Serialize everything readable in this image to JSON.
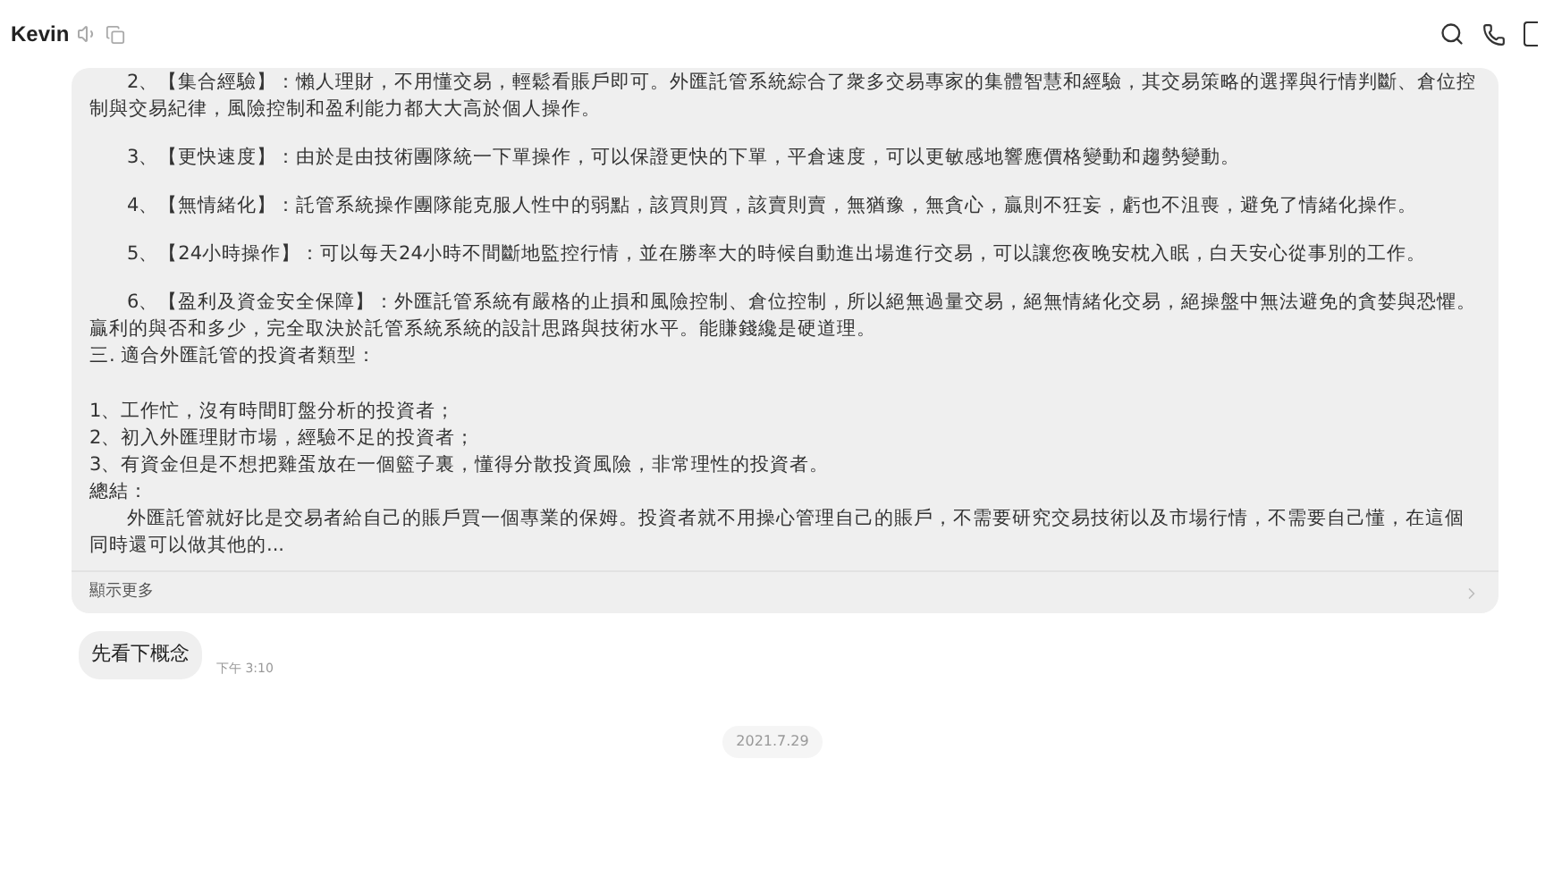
{
  "header": {
    "name": "Kevin"
  },
  "message_card": {
    "paragraphs": [
      {
        "kind": "point",
        "text": "2、【集合經驗】：懶人理財，不用懂交易，輕鬆看賬戶即可。外匯託管系統綜合了衆多交易專家的集體智慧和經驗，其交易策略的選擇與行情判斷、倉位控制與交易紀律，風險控制和盈利能力都大大高於個人操作。"
      },
      {
        "kind": "point",
        "text": "3、【更快速度】：由於是由技術團隊統一下單操作，可以保證更快的下單，平倉速度，可以更敏感地響應價格變動和趨勢變動。"
      },
      {
        "kind": "point",
        "text": "4、【無情緒化】：託管系統操作團隊能克服人性中的弱點，該買則買，該賣則賣，無猶豫，無貪心，贏則不狂妄，虧也不沮喪，避免了情緒化操作。"
      },
      {
        "kind": "point",
        "text": "5、【24小時操作】：可以每天24小時不間斷地監控行情，並在勝率大的時候自動進出場進行交易，可以讓您夜晚安枕入眠，白天安心從事別的工作。"
      },
      {
        "kind": "summary",
        "text": "6、【盈利及資金安全保障】：外匯託管系統有嚴格的止損和風險控制、倉位控制，所以絕無過量交易，絕無情緒化交易，絕操盤中無法避免的貪婪與恐懼。贏利的與否和多少，完全取決於託管系統系統的設計思路與技術水平。能賺錢纔是硬道理。"
      },
      {
        "kind": "heading",
        "text": "三. 適合外匯託管的投資者類型："
      },
      {
        "kind": "line",
        "text": "1、工作忙，沒有時間盯盤分析的投資者；"
      },
      {
        "kind": "line",
        "text": "2、初入外匯理財市場，經驗不足的投資者；"
      },
      {
        "kind": "line",
        "text": "3、有資金但是不想把雞蛋放在一個籃子裏，懂得分散投資風險，非常理性的投資者。"
      },
      {
        "kind": "line",
        "text": "總結："
      },
      {
        "kind": "summary",
        "text": "外匯託管就好比是交易者給自己的賬戶買一個專業的保姆。投資者就不用操心管理自己的賬戶，不需要研究交易技術以及市場行情，不需要自己懂，在這個同時還可以做其他的..."
      }
    ],
    "show_more": "顯示更多"
  },
  "reply": {
    "text": "先看下概念",
    "time": "下午 3:10"
  },
  "date_divider": "2021.7.29"
}
